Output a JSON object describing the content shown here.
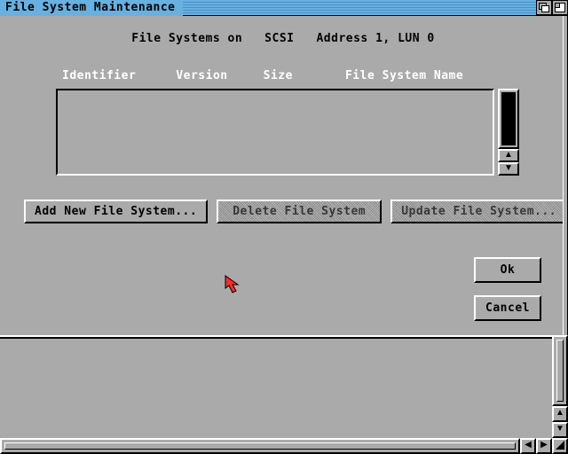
{
  "window": {
    "title": "File System Maintenance"
  },
  "heading": {
    "prefix": "File Systems on",
    "bus": "SCSI",
    "address_label": "Address",
    "address_value": "1",
    "lun_label": "LUN",
    "lun_value": "0"
  },
  "columns": {
    "identifier": "Identifier",
    "version": "Version",
    "size": "Size",
    "filesystem_name": "File System Name"
  },
  "filesystems": [],
  "buttons": {
    "add": "Add New File System...",
    "delete": "Delete File System",
    "update": "Update File System...",
    "ok": "Ok",
    "cancel": "Cancel"
  },
  "scroll": {
    "up_glyph": "▲",
    "down_glyph": "▼",
    "left_glyph": "◀",
    "right_glyph": "▶"
  }
}
